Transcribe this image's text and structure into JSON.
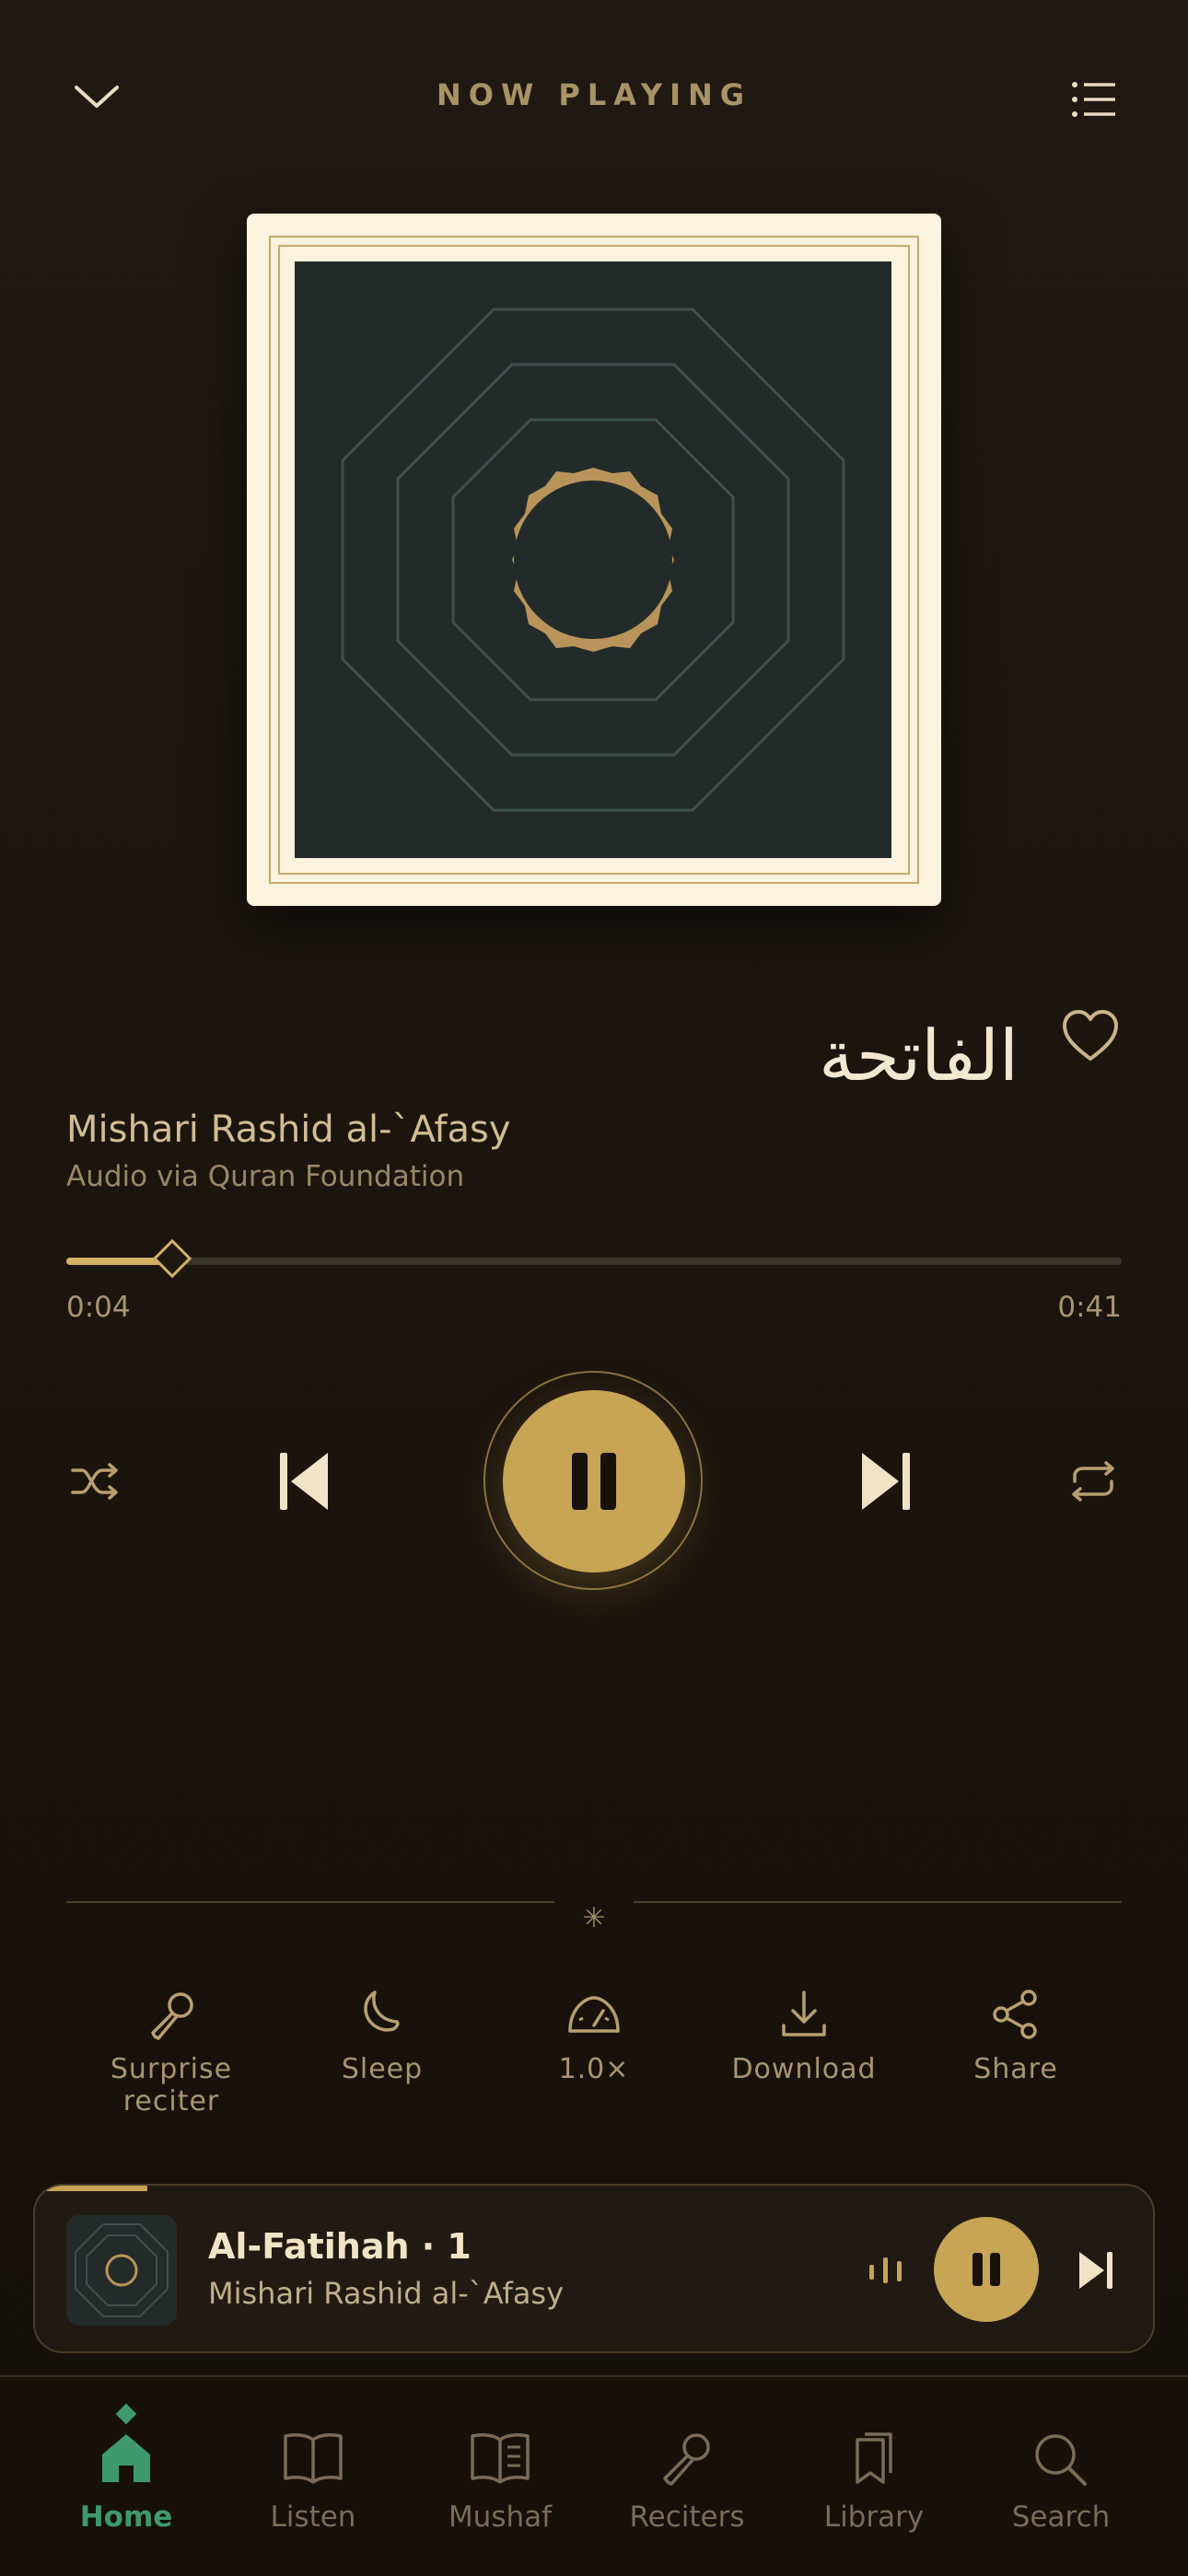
{
  "header": {
    "title": "NOW PLAYING",
    "collapse_icon": "chevron-down-icon",
    "queue_icon": "list-icon"
  },
  "track": {
    "surah_arabic": "الفاتحة",
    "reciter": "Mishari Rashid al-`Afasy",
    "source": "Audio via Quran Foundation",
    "favorite_icon": "heart-icon"
  },
  "progress": {
    "elapsed": "0:04",
    "duration": "0:41",
    "fraction": 0.1
  },
  "controls": {
    "shuffle_icon": "shuffle-icon",
    "previous_icon": "skip-previous-icon",
    "play_state_icon": "pause-icon",
    "next_icon": "skip-next-icon",
    "repeat_icon": "repeat-icon"
  },
  "actions": [
    {
      "label": "Surprise reciter",
      "icon": "microphone-icon"
    },
    {
      "label": "Sleep",
      "icon": "moon-icon"
    },
    {
      "label": "1.0×",
      "icon": "speedometer-icon"
    },
    {
      "label": "Download",
      "icon": "download-icon"
    },
    {
      "label": "Share",
      "icon": "share-icon"
    }
  ],
  "mini_player": {
    "title": "Al-Fatihah · 1",
    "subtitle": "Mishari Rashid al-`Afasy",
    "progress_fraction": 0.1
  },
  "tabs": [
    {
      "label": "Home",
      "icon": "home-icon",
      "active": true
    },
    {
      "label": "Listen",
      "icon": "open-book-icon",
      "active": false
    },
    {
      "label": "Mushaf",
      "icon": "mushaf-icon",
      "active": false
    },
    {
      "label": "Reciters",
      "icon": "microphone-icon",
      "active": false
    },
    {
      "label": "Library",
      "icon": "bookmark-icon",
      "active": false
    },
    {
      "label": "Search",
      "icon": "search-icon",
      "active": false
    }
  ],
  "colors": {
    "accent_gold": "#c8a455",
    "active_green": "#3e9a6e",
    "background": "#1b140d"
  }
}
